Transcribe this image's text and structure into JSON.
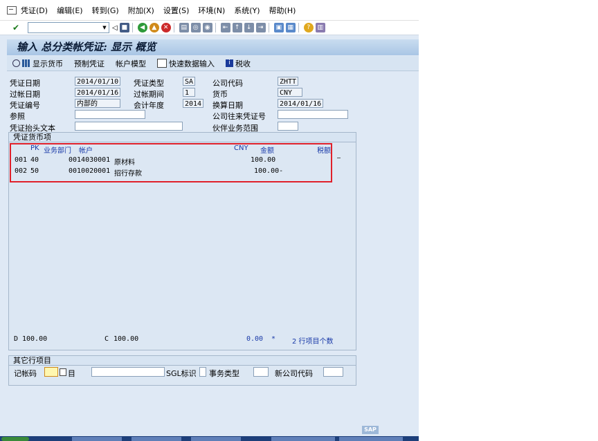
{
  "menu": [
    "凭证(D)",
    "编辑(E)",
    "转到(G)",
    "附加(X)",
    "设置(S)",
    "环境(N)",
    "系统(Y)",
    "帮助(H)"
  ],
  "screen_title": "输入 总分类帐凭证: 显示 概览",
  "app_toolbar": {
    "display_currency": "显示货币",
    "park_document": "预制凭证",
    "account_model": "帐户模型",
    "fast_entry": "快速数据输入",
    "tax": "税收"
  },
  "header": {
    "doc_date_label": "凭证日期",
    "doc_date": "2014/01/10",
    "doc_type_label": "凭证类型",
    "doc_type": "SA",
    "company_code_label": "公司代码",
    "company_code": "ZHTT",
    "posting_date_label": "过帐日期",
    "posting_date": "2014/01/16",
    "period_label": "过帐期间",
    "period": "1",
    "currency_label": "货币",
    "currency": "CNY",
    "doc_number_label": "凭证编号",
    "doc_number": "内部的",
    "fiscal_year_label": "会计年度",
    "fiscal_year": "2014",
    "translation_date_label": "换算日期",
    "translation_date": "2014/01/16",
    "reference_label": "参照",
    "reference": "",
    "intercompany_label": "公司往来凭证号",
    "intercompany": "",
    "header_text_label": "凭证抬头文本",
    "header_text": "",
    "partner_ba_label": "伙伴业务范围",
    "partner_ba": ""
  },
  "items": {
    "group_title": "凭证货币项",
    "columns": {
      "pk": "PK",
      "ba": "业务部门",
      "account": "帐户",
      "currency": "CNY",
      "amount": "金额",
      "tax": "税额"
    },
    "rows": [
      {
        "line": "001",
        "pk": "40",
        "account": "0014030001",
        "name": "原材料",
        "amount": "100.00"
      },
      {
        "line": "002",
        "pk": "50",
        "account": "0010020001",
        "name": "招行存款",
        "amount": "100.00-"
      }
    ],
    "debit_label": "D",
    "debit": "100.00",
    "credit_label": "C",
    "credit": "100.00",
    "balance": "0.00",
    "balance_flag": "*",
    "count_text": "2 行项目个数"
  },
  "other_item": {
    "group_title": "其它行项目",
    "posting_key_label": "记帐码",
    "posting_key": "",
    "account_label": "目",
    "account": "",
    "sgl_label": "SGL标识",
    "sgl": "",
    "trans_type_label": "事务类型",
    "trans_type": "",
    "new_company_label": "新公司代码",
    "new_company": ""
  },
  "logo": "SAP"
}
